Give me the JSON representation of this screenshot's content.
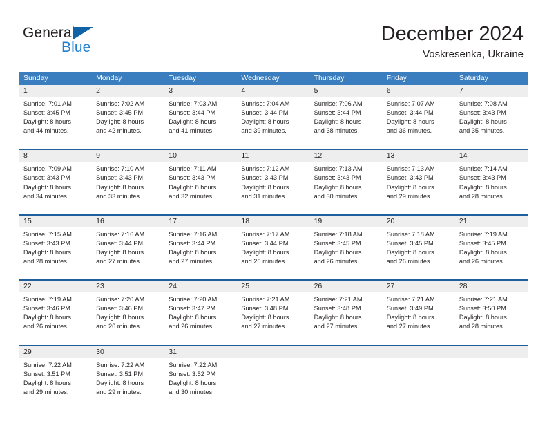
{
  "brand": {
    "name_part1": "General",
    "name_part2": "Blue",
    "accent_color": "#1f7fd0",
    "triangle_color": "#1163a8"
  },
  "header": {
    "month_title": "December 2024",
    "location": "Voskresenka, Ukraine"
  },
  "calendar": {
    "header_color": "#3a7ebf",
    "rule_color": "#1f5f9e",
    "daynum_band_color": "#eeeeee",
    "weekdays": [
      "Sunday",
      "Monday",
      "Tuesday",
      "Wednesday",
      "Thursday",
      "Friday",
      "Saturday"
    ],
    "weeks": [
      [
        {
          "day": "1",
          "sunrise": "Sunrise: 7:01 AM",
          "sunset": "Sunset: 3:45 PM",
          "daylight_line1": "Daylight: 8 hours",
          "daylight_line2": "and 44 minutes."
        },
        {
          "day": "2",
          "sunrise": "Sunrise: 7:02 AM",
          "sunset": "Sunset: 3:45 PM",
          "daylight_line1": "Daylight: 8 hours",
          "daylight_line2": "and 42 minutes."
        },
        {
          "day": "3",
          "sunrise": "Sunrise: 7:03 AM",
          "sunset": "Sunset: 3:44 PM",
          "daylight_line1": "Daylight: 8 hours",
          "daylight_line2": "and 41 minutes."
        },
        {
          "day": "4",
          "sunrise": "Sunrise: 7:04 AM",
          "sunset": "Sunset: 3:44 PM",
          "daylight_line1": "Daylight: 8 hours",
          "daylight_line2": "and 39 minutes."
        },
        {
          "day": "5",
          "sunrise": "Sunrise: 7:06 AM",
          "sunset": "Sunset: 3:44 PM",
          "daylight_line1": "Daylight: 8 hours",
          "daylight_line2": "and 38 minutes."
        },
        {
          "day": "6",
          "sunrise": "Sunrise: 7:07 AM",
          "sunset": "Sunset: 3:44 PM",
          "daylight_line1": "Daylight: 8 hours",
          "daylight_line2": "and 36 minutes."
        },
        {
          "day": "7",
          "sunrise": "Sunrise: 7:08 AM",
          "sunset": "Sunset: 3:43 PM",
          "daylight_line1": "Daylight: 8 hours",
          "daylight_line2": "and 35 minutes."
        }
      ],
      [
        {
          "day": "8",
          "sunrise": "Sunrise: 7:09 AM",
          "sunset": "Sunset: 3:43 PM",
          "daylight_line1": "Daylight: 8 hours",
          "daylight_line2": "and 34 minutes."
        },
        {
          "day": "9",
          "sunrise": "Sunrise: 7:10 AM",
          "sunset": "Sunset: 3:43 PM",
          "daylight_line1": "Daylight: 8 hours",
          "daylight_line2": "and 33 minutes."
        },
        {
          "day": "10",
          "sunrise": "Sunrise: 7:11 AM",
          "sunset": "Sunset: 3:43 PM",
          "daylight_line1": "Daylight: 8 hours",
          "daylight_line2": "and 32 minutes."
        },
        {
          "day": "11",
          "sunrise": "Sunrise: 7:12 AM",
          "sunset": "Sunset: 3:43 PM",
          "daylight_line1": "Daylight: 8 hours",
          "daylight_line2": "and 31 minutes."
        },
        {
          "day": "12",
          "sunrise": "Sunrise: 7:13 AM",
          "sunset": "Sunset: 3:43 PM",
          "daylight_line1": "Daylight: 8 hours",
          "daylight_line2": "and 30 minutes."
        },
        {
          "day": "13",
          "sunrise": "Sunrise: 7:13 AM",
          "sunset": "Sunset: 3:43 PM",
          "daylight_line1": "Daylight: 8 hours",
          "daylight_line2": "and 29 minutes."
        },
        {
          "day": "14",
          "sunrise": "Sunrise: 7:14 AM",
          "sunset": "Sunset: 3:43 PM",
          "daylight_line1": "Daylight: 8 hours",
          "daylight_line2": "and 28 minutes."
        }
      ],
      [
        {
          "day": "15",
          "sunrise": "Sunrise: 7:15 AM",
          "sunset": "Sunset: 3:43 PM",
          "daylight_line1": "Daylight: 8 hours",
          "daylight_line2": "and 28 minutes."
        },
        {
          "day": "16",
          "sunrise": "Sunrise: 7:16 AM",
          "sunset": "Sunset: 3:44 PM",
          "daylight_line1": "Daylight: 8 hours",
          "daylight_line2": "and 27 minutes."
        },
        {
          "day": "17",
          "sunrise": "Sunrise: 7:16 AM",
          "sunset": "Sunset: 3:44 PM",
          "daylight_line1": "Daylight: 8 hours",
          "daylight_line2": "and 27 minutes."
        },
        {
          "day": "18",
          "sunrise": "Sunrise: 7:17 AM",
          "sunset": "Sunset: 3:44 PM",
          "daylight_line1": "Daylight: 8 hours",
          "daylight_line2": "and 26 minutes."
        },
        {
          "day": "19",
          "sunrise": "Sunrise: 7:18 AM",
          "sunset": "Sunset: 3:45 PM",
          "daylight_line1": "Daylight: 8 hours",
          "daylight_line2": "and 26 minutes."
        },
        {
          "day": "20",
          "sunrise": "Sunrise: 7:18 AM",
          "sunset": "Sunset: 3:45 PM",
          "daylight_line1": "Daylight: 8 hours",
          "daylight_line2": "and 26 minutes."
        },
        {
          "day": "21",
          "sunrise": "Sunrise: 7:19 AM",
          "sunset": "Sunset: 3:45 PM",
          "daylight_line1": "Daylight: 8 hours",
          "daylight_line2": "and 26 minutes."
        }
      ],
      [
        {
          "day": "22",
          "sunrise": "Sunrise: 7:19 AM",
          "sunset": "Sunset: 3:46 PM",
          "daylight_line1": "Daylight: 8 hours",
          "daylight_line2": "and 26 minutes."
        },
        {
          "day": "23",
          "sunrise": "Sunrise: 7:20 AM",
          "sunset": "Sunset: 3:46 PM",
          "daylight_line1": "Daylight: 8 hours",
          "daylight_line2": "and 26 minutes."
        },
        {
          "day": "24",
          "sunrise": "Sunrise: 7:20 AM",
          "sunset": "Sunset: 3:47 PM",
          "daylight_line1": "Daylight: 8 hours",
          "daylight_line2": "and 26 minutes."
        },
        {
          "day": "25",
          "sunrise": "Sunrise: 7:21 AM",
          "sunset": "Sunset: 3:48 PM",
          "daylight_line1": "Daylight: 8 hours",
          "daylight_line2": "and 27 minutes."
        },
        {
          "day": "26",
          "sunrise": "Sunrise: 7:21 AM",
          "sunset": "Sunset: 3:48 PM",
          "daylight_line1": "Daylight: 8 hours",
          "daylight_line2": "and 27 minutes."
        },
        {
          "day": "27",
          "sunrise": "Sunrise: 7:21 AM",
          "sunset": "Sunset: 3:49 PM",
          "daylight_line1": "Daylight: 8 hours",
          "daylight_line2": "and 27 minutes."
        },
        {
          "day": "28",
          "sunrise": "Sunrise: 7:21 AM",
          "sunset": "Sunset: 3:50 PM",
          "daylight_line1": "Daylight: 8 hours",
          "daylight_line2": "and 28 minutes."
        }
      ],
      [
        {
          "day": "29",
          "sunrise": "Sunrise: 7:22 AM",
          "sunset": "Sunset: 3:51 PM",
          "daylight_line1": "Daylight: 8 hours",
          "daylight_line2": "and 29 minutes."
        },
        {
          "day": "30",
          "sunrise": "Sunrise: 7:22 AM",
          "sunset": "Sunset: 3:51 PM",
          "daylight_line1": "Daylight: 8 hours",
          "daylight_line2": "and 29 minutes."
        },
        {
          "day": "31",
          "sunrise": "Sunrise: 7:22 AM",
          "sunset": "Sunset: 3:52 PM",
          "daylight_line1": "Daylight: 8 hours",
          "daylight_line2": "and 30 minutes."
        },
        {
          "day": "",
          "sunrise": "",
          "sunset": "",
          "daylight_line1": "",
          "daylight_line2": ""
        },
        {
          "day": "",
          "sunrise": "",
          "sunset": "",
          "daylight_line1": "",
          "daylight_line2": ""
        },
        {
          "day": "",
          "sunrise": "",
          "sunset": "",
          "daylight_line1": "",
          "daylight_line2": ""
        },
        {
          "day": "",
          "sunrise": "",
          "sunset": "",
          "daylight_line1": "",
          "daylight_line2": ""
        }
      ]
    ]
  }
}
